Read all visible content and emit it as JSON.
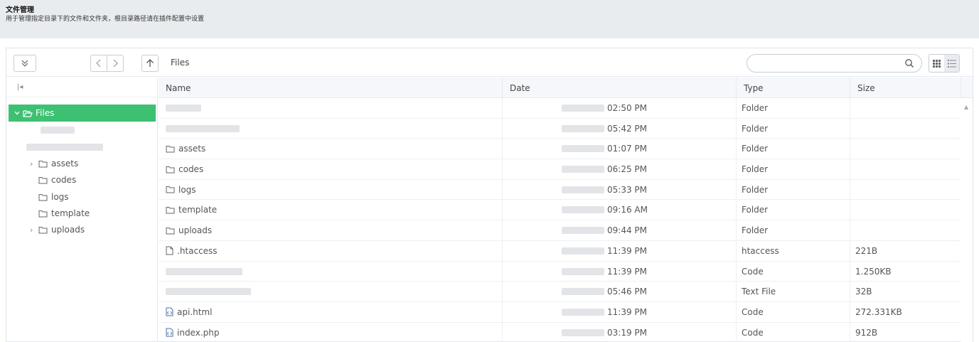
{
  "header": {
    "title": "文件管理",
    "description": "用于管理指定目录下的文件和文件夹，根目录路径请在插件配置中设置"
  },
  "toolbar": {
    "breadcrumb": "Files",
    "search_placeholder": ""
  },
  "tree": {
    "root_label": "Files",
    "children": [
      {
        "label": "assets",
        "expandable": true
      },
      {
        "label": "codes",
        "expandable": false
      },
      {
        "label": "logs",
        "expandable": false
      },
      {
        "label": "template",
        "expandable": false
      },
      {
        "label": "uploads",
        "expandable": true
      }
    ]
  },
  "columns": [
    "Name",
    "Date",
    "Type",
    "Size"
  ],
  "rows": [
    {
      "name": "",
      "icon": "blurred",
      "date": "02:50 PM",
      "type": "Folder",
      "size": ""
    },
    {
      "name": "",
      "icon": "blurred",
      "date": "05:42 PM",
      "type": "Folder",
      "size": ""
    },
    {
      "name": "assets",
      "icon": "folder-icon",
      "date": "01:07 PM",
      "type": "Folder",
      "size": ""
    },
    {
      "name": "codes",
      "icon": "folder-icon",
      "date": "06:25 PM",
      "type": "Folder",
      "size": ""
    },
    {
      "name": "logs",
      "icon": "folder-icon",
      "date": "05:33 PM",
      "type": "Folder",
      "size": ""
    },
    {
      "name": "template",
      "icon": "folder-icon",
      "date": "09:16 AM",
      "type": "Folder",
      "size": ""
    },
    {
      "name": "uploads",
      "icon": "folder-icon",
      "date": "09:44 PM",
      "type": "Folder",
      "size": ""
    },
    {
      "name": ".htaccess",
      "icon": "file-icon",
      "date": "11:39 PM",
      "type": "htaccess",
      "size": "221B"
    },
    {
      "name": "",
      "icon": "blurred",
      "date": "11:39 PM",
      "type": "Code",
      "size": "1.250KB"
    },
    {
      "name": "",
      "icon": "blurred",
      "date": "05:46 PM",
      "type": "Text File",
      "size": "32B"
    },
    {
      "name": "api.html",
      "icon": "code-file-icon",
      "date": "11:39 PM",
      "type": "Code",
      "size": "272.331KB"
    },
    {
      "name": "index.php",
      "icon": "code-file-icon",
      "date": "03:19 PM",
      "type": "Code",
      "size": "912B"
    }
  ],
  "colors": {
    "accent": "#3ec072",
    "header_bg": "#e9ecef",
    "list_head_bg": "#f5f7fa"
  }
}
